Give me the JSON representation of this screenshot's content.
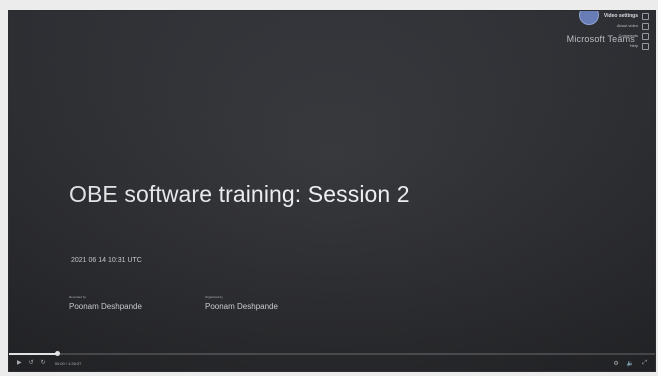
{
  "window": {
    "brand": "Microsoft Teams"
  },
  "overlay_menu": {
    "items": [
      {
        "label": "Video settings",
        "icon": "gear-icon"
      },
      {
        "label": "About video",
        "icon": "info-icon"
      },
      {
        "label": "Comments",
        "icon": "comment-icon"
      },
      {
        "label": "Help",
        "icon": "help-icon"
      }
    ]
  },
  "slide": {
    "title": "OBE software training: Session 2",
    "date": "2021 06 14 10:31 UTC",
    "recorded_by_label": "Recorded by",
    "recorded_by": "Poonam Deshpande",
    "organized_by_label": "Organized by",
    "organized_by": "Poonam Deshpande"
  },
  "player": {
    "progress_percent": 7.5,
    "time_text": "00:00 / 1:26:37",
    "icons": {
      "play": "play-icon",
      "rewind": "rewind-icon",
      "forward": "forward-icon",
      "settings": "settings-icon",
      "fullscreen": "fullscreen-icon",
      "volume": "volume-icon"
    }
  },
  "colors": {
    "background": "#2a2b2f",
    "accent": "#6f86c6",
    "text": "#f1f2f4"
  }
}
